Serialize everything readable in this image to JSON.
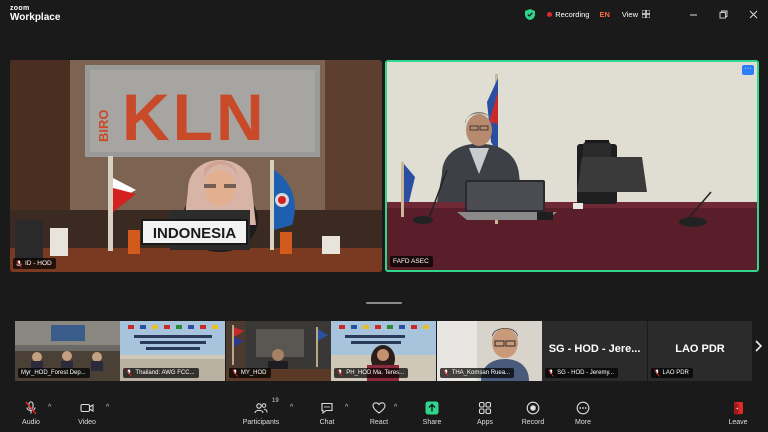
{
  "app": {
    "brand_line1": "zoom",
    "brand_line2": "Workplace"
  },
  "titlebar": {
    "recording_label": "Recording",
    "language": "EN",
    "view_label": "View",
    "colors": {
      "recording": "#e02828",
      "language": "#ff6a3d",
      "shield": "#2fd58a"
    }
  },
  "main_tiles": [
    {
      "name": "ID - HOD",
      "muted": true,
      "sign_text": "INDONESIA",
      "wall_text": "KLN",
      "wall_small": "BIRO"
    },
    {
      "name": "FAFD ASEC",
      "muted": false,
      "active_speaker": true,
      "more_label": "···"
    }
  ],
  "gallery": [
    {
      "name": "Myr_HOD_Forest Dep...",
      "muted": false
    },
    {
      "name": "Thailand: AWG FCC...",
      "muted": true
    },
    {
      "name": "MY_HOD",
      "muted": true
    },
    {
      "name": "PH_HOD Ma. Teres...",
      "muted": true
    },
    {
      "name": "THA_Komsan Ruea...",
      "muted": true
    },
    {
      "name": "SG - HOD - Jeremy...",
      "muted": true,
      "tile_text": "SG - HOD - Jere..."
    },
    {
      "name": "LAO PDR",
      "muted": true,
      "tile_text": "LAO PDR"
    }
  ],
  "toolbar": {
    "audio": "Audio",
    "video": "Video",
    "participants": "Participants",
    "participants_count": "19",
    "chat": "Chat",
    "react": "React",
    "share": "Share",
    "apps": "Apps",
    "record": "Record",
    "more": "More",
    "leave": "Leave",
    "colors": {
      "share": "#2fd58a",
      "leave": "#e02828",
      "audio_off": "#e02828"
    }
  }
}
